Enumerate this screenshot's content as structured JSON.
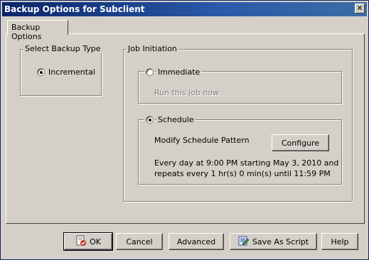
{
  "window": {
    "title": "Backup Options for Subclient",
    "close_glyph": "✕"
  },
  "tab": {
    "label": "Backup Options"
  },
  "backup_type": {
    "legend": "Select Backup Type",
    "option_label": "Incremental",
    "selected": true
  },
  "job_initiation": {
    "legend": "Job Initiation",
    "immediate": {
      "label": "Immediate",
      "description": "Run this job now",
      "selected": false
    },
    "schedule": {
      "label": "Schedule",
      "selected": true,
      "pattern_label": "Modify Schedule Pattern",
      "configure_label": "Configure",
      "summary_line1": "Every day at 9:00 PM  starting May 3, 2010 and",
      "summary_line2": "repeats every 1 hr(s) 0 min(s) until 11:59 PM"
    }
  },
  "buttons": {
    "ok": "OK",
    "cancel": "Cancel",
    "advanced": "Advanced",
    "save_as_script": "Save As Script",
    "help": "Help"
  },
  "icons": {
    "ok": "ok-icon",
    "save_as_script": "save-script-icon",
    "close": "close-icon"
  }
}
